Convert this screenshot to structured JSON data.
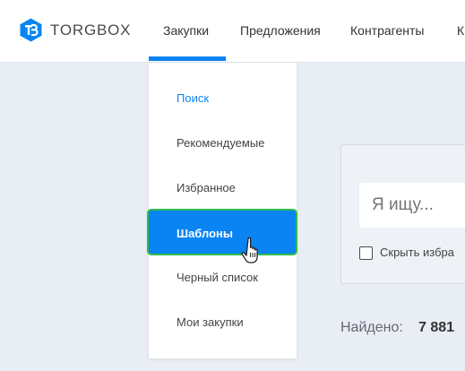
{
  "brand": {
    "name": "TORGBOX",
    "icon": "tb-logo-icon",
    "color": "#0a84f3"
  },
  "nav": {
    "items": [
      {
        "label": "Закупки"
      },
      {
        "label": "Предложения"
      },
      {
        "label": "Контрагенты"
      },
      {
        "label": "К"
      }
    ],
    "active_index": 0
  },
  "dropdown": {
    "items": [
      {
        "label": "Поиск"
      },
      {
        "label": "Рекомендуемые"
      },
      {
        "label": "Избранное"
      },
      {
        "label": "Шаблоны"
      },
      {
        "label": "Черный список"
      },
      {
        "label": "Мои закупки"
      }
    ],
    "highlighted_index": 0,
    "selected_index": 3
  },
  "search": {
    "placeholder": "Я ищу...",
    "hide_favorites_label": "Скрыть избра"
  },
  "results": {
    "found_label": "Найдено:",
    "found_count": "7 881"
  },
  "colors": {
    "accent": "#0a84f3",
    "selected_border": "#2bbd4e",
    "background": "#e9eef4"
  }
}
